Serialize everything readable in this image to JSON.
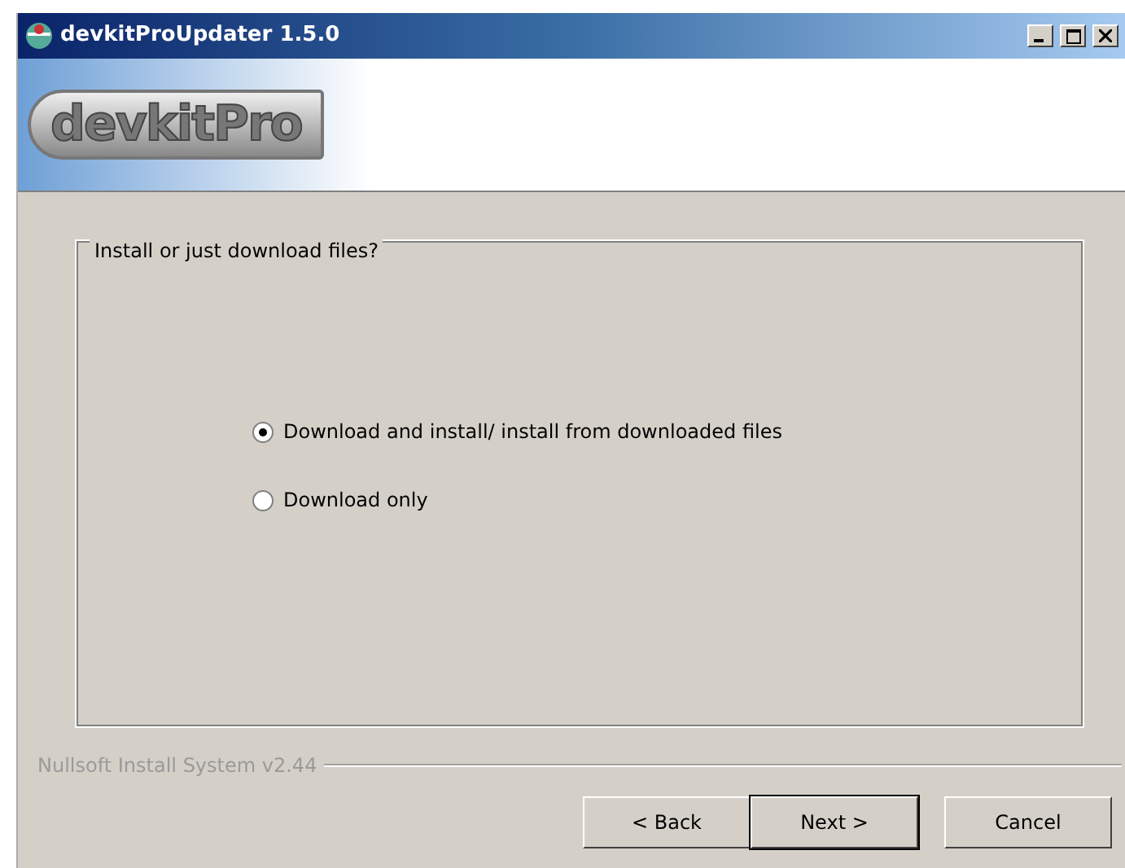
{
  "window": {
    "title": "devkitProUpdater 1.5.0"
  },
  "header": {
    "logo": "devkitPro"
  },
  "group": {
    "legend": "Install or just download files?",
    "options": [
      {
        "label": "Download and install/ install from downloaded files",
        "selected": true
      },
      {
        "label": "Download only",
        "selected": false
      }
    ]
  },
  "branding": "Nullsoft Install System v2.44",
  "buttons": [
    {
      "label": "< Back",
      "default": false
    },
    {
      "label": "Next >",
      "default": true
    },
    {
      "label": "Cancel",
      "default": false
    }
  ]
}
